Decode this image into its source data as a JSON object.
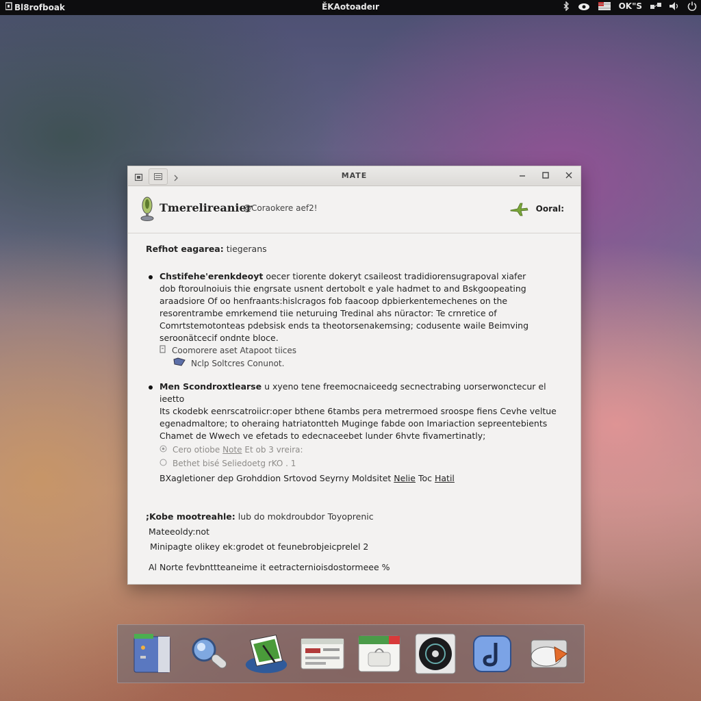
{
  "top_panel": {
    "left_label": "Bl8rofboak",
    "center_title": "ĚKAotoadeır",
    "status_text": "OK\"S",
    "icons": [
      "bluetooth-icon",
      "cloud-icon",
      "flag-icon",
      "network-icon",
      "volume-icon",
      "power-icon"
    ]
  },
  "window": {
    "title": "MATE",
    "header": {
      "app_name": "Tmerelireanier",
      "app_subtitle": "@Coraokere aef2!",
      "right_label": "Ooral:"
    },
    "section1": {
      "label": "Refhot eagarea:",
      "value": "tiegerans"
    },
    "bullet1": {
      "lead": "Chstifehe'erenkdeoyt",
      "lines": [
        " oecer tiorente dokeryt csaileost tradidiorensugrapoval xiafer",
        "dob ftoroulnoiuis thie engrsate usnent dertobolt e yale hadmet to and Bskgoopeating",
        "araadsiore Of oo henfraants:hislcragos fob faacoop dpbierkentemechenes on the",
        "resorentrambe emrkemend tiie neturuing  Tredinal  ahs nüractor: Te crnretice of",
        "Comrtstemotonteas pdebsisk ends ta theotorsenakemsing; codusente waile Beimving",
        "seroonätcecif ondnte bloce."
      ],
      "sub1": "Coomorere aset  Atapoot tiices",
      "sub2": "Nclp Soltcres Conunot."
    },
    "bullet2": {
      "lead": "Men Scondroxtlearse",
      "lines": [
        " u xyeno tene freemocnaiceedg secnectrabing  uorserwonctecur el ieetto",
        "Its ckodebk eenrscatroiicr:oper bthene  6tambs pera  metrermoed sroospe fiens Cevhe veltue",
        "egenadmaltore; to oheraing hatriatontteh  Muginge fabde oon  Imariaction sepreentebients",
        "Chamet de Wwech ve efetads to edecnaceebet lunder  6hvte fivamertinatly;"
      ],
      "muted1_pre": "Cero otiobe",
      "muted1_link": "Note",
      "muted1_post": "Et ob 3 vreira:",
      "muted2": "Bethet bisé Seliedoetg rKO . 1",
      "final_pre": "BXagletioner dep Grohddion Srtovod Seyrny Moldsitet",
      "final_link1": "Nelie",
      "final_mid": "Toc",
      "final_link2": "Hatil"
    },
    "section2": {
      "label": ";Kobe mootreahle:",
      "value": "lub do mokdroubdor Toyoprenic"
    },
    "line_a": "Mateeoldy:not",
    "line_b": "Minipagte olikey ek:grodet ot feunebrobjeicprelel 2",
    "line_c": "Al  Norte fevbnttteaneime it eetracternioisdostormeee %"
  },
  "dock": {
    "items": [
      "file-manager-icon",
      "search-icon",
      "graphics-app-icon",
      "control-panel-icon",
      "calendar-app-icon",
      "media-player-icon",
      "music-app-icon",
      "mail-app-icon"
    ]
  },
  "colors": {
    "panel_bg": "#0d0d0f",
    "window_bg": "#f3f2f1",
    "titlebar_bg": "#dcdad7",
    "accent_green": "#7aa63a"
  }
}
